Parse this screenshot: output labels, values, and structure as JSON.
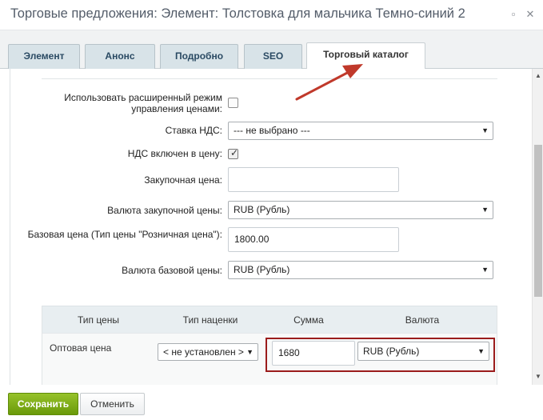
{
  "window": {
    "title": "Торговые предложения: Элемент: Толстовка для мальчика Темно-синий 2",
    "minimize_glyph": "▫",
    "close_glyph": "✕"
  },
  "tabs": [
    {
      "label": "Элемент",
      "active": false
    },
    {
      "label": "Анонс",
      "active": false
    },
    {
      "label": "Подробно",
      "active": false
    },
    {
      "label": "SEO",
      "active": false
    },
    {
      "label": "Торговый каталог",
      "active": true
    }
  ],
  "form": {
    "extended_price_mode": {
      "label": "Использовать расширенный режим управления ценами:",
      "checked": false
    },
    "vat_rate": {
      "label": "Ставка НДС:",
      "value": "--- не выбрано ---"
    },
    "vat_included": {
      "label": "НДС включен в цену:",
      "checked": true
    },
    "purchase_price": {
      "label": "Закупочная цена:",
      "value": ""
    },
    "purchase_currency": {
      "label": "Валюта закупочной цены:",
      "value": "RUB (Рубль)"
    },
    "base_price": {
      "label": "Базовая цена (Тип цены \"Розничная цена\"):",
      "value": "1800.00"
    },
    "base_currency": {
      "label": "Валюта базовой цены:",
      "value": "RUB (Рубль)"
    }
  },
  "price_table": {
    "headers": [
      "Тип цены",
      "Тип наценки",
      "Сумма",
      "Валюта"
    ],
    "rows": [
      {
        "price_type": "Оптовая цена",
        "markup": "< не установлен >",
        "amount": "1680",
        "currency": "RUB (Рубль)"
      }
    ]
  },
  "footer": {
    "save_label": "Сохранить",
    "cancel_label": "Отменить"
  },
  "icons": {
    "select_caret": "▼",
    "checkmark": "✓",
    "scroll_up": "▲",
    "scroll_down": "▼"
  },
  "colors": {
    "highlight_border": "#9b1c1c",
    "annotation_arrow": "#c0392b",
    "save_button": "#7aab12",
    "active_tab": "#ffffff",
    "inactive_tab": "#d8e3e8"
  }
}
